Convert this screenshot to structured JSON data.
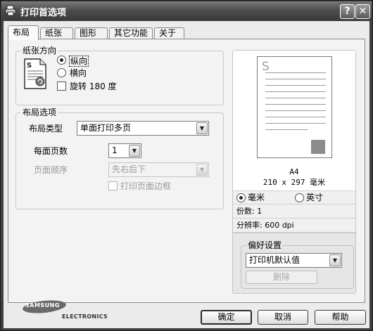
{
  "window": {
    "title": "打印首选项",
    "help_glyph": "?",
    "close_glyph": "✕"
  },
  "tabs": [
    {
      "label": "布局",
      "active": true
    },
    {
      "label": "纸张",
      "active": false
    },
    {
      "label": "图形",
      "active": false
    },
    {
      "label": "其它功能",
      "active": false
    },
    {
      "label": "关于",
      "active": false
    }
  ],
  "orientation": {
    "group_label": "纸张方向",
    "portrait_label": "纵向",
    "landscape_label": "横向",
    "selected": "portrait",
    "rotate_label": "旋转 180 度",
    "rotate_checked": false
  },
  "layout_options": {
    "group_label": "布局选项",
    "layout_type_label": "布局类型",
    "layout_type_value": "单面打印多页",
    "pages_per_side_label": "每面页数",
    "pages_per_side_value": "1",
    "page_order_label": "页面顺序",
    "page_order_value": "先右后下",
    "print_border_label": "打印页面边框",
    "print_border_checked": false
  },
  "preview": {
    "page_glyph": "S",
    "paper_name": "A4",
    "paper_size": "210 x 297 毫米",
    "unit_mm_label": "毫米",
    "unit_inch_label": "英寸",
    "unit_selected": "mm",
    "copies_text": "份数: 1",
    "resolution_text": "分辨率: 600 dpi"
  },
  "favorites": {
    "group_label": "偏好设置",
    "value": "打印机默认值",
    "delete_label": "删除"
  },
  "brand": {
    "logo_text": "SAMSUNG",
    "logo_sub": "ELECTRONICS"
  },
  "footer": {
    "ok_label": "确定",
    "cancel_label": "取消",
    "help_label": "帮助"
  },
  "colors": {
    "titlebar": "#4e4e4e",
    "dialog_bg": "#ebebeb",
    "panel_bg": "#f3f3f3"
  }
}
